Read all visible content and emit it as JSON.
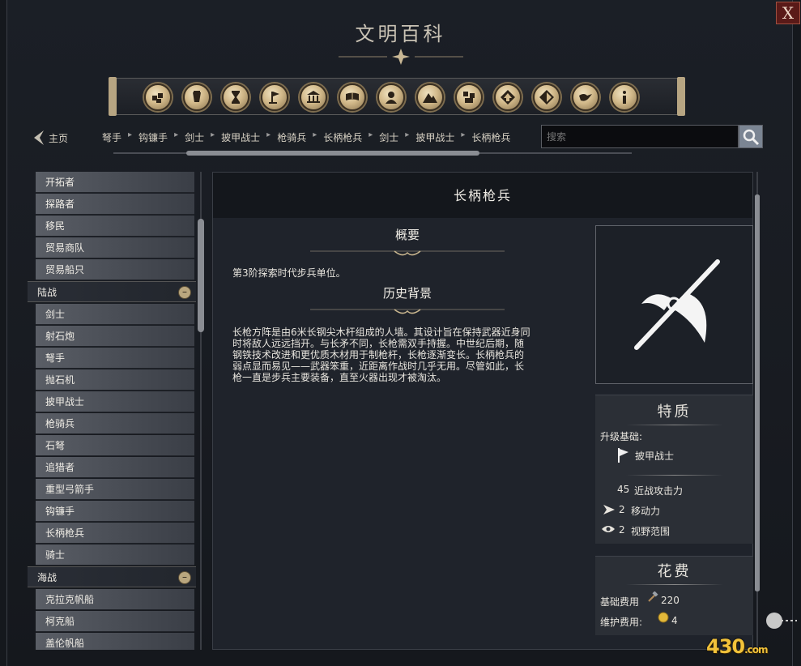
{
  "window": {
    "title": "文明百科",
    "close_label": "X"
  },
  "categories": [
    {
      "name": "units-icon"
    },
    {
      "name": "buildings-icon"
    },
    {
      "name": "wonders-icon"
    },
    {
      "name": "civilizations-icon"
    },
    {
      "name": "government-icon"
    },
    {
      "name": "technology-icon"
    },
    {
      "name": "great-people-icon"
    },
    {
      "name": "terrain-icon"
    },
    {
      "name": "resources-icon"
    },
    {
      "name": "improvements-icon"
    },
    {
      "name": "religion-icon"
    },
    {
      "name": "diplomacy-icon"
    },
    {
      "name": "info-icon"
    }
  ],
  "nav": {
    "home_label": "主页",
    "breadcrumbs": [
      "弩手",
      "钩镰手",
      "剑士",
      "披甲战士",
      "枪骑兵",
      "长柄枪兵",
      "剑士",
      "披甲战士",
      "长柄枪兵"
    ],
    "search_placeholder": "搜索"
  },
  "sidebar": {
    "items_top": [
      "开拓者",
      "探路者",
      "移民",
      "贸易商队",
      "贸易船只"
    ],
    "land_header": "陆战",
    "land_items": [
      "剑士",
      "射石炮",
      "弩手",
      "抛石机",
      "披甲战士",
      "枪骑兵",
      "石弩",
      "追猎者",
      "重型弓箭手",
      "钩镰手",
      "长柄枪兵",
      "骑士"
    ],
    "naval_header": "海战",
    "naval_items": [
      "克拉克帆船",
      "柯克船",
      "盖伦帆船"
    ]
  },
  "article": {
    "title": "长柄枪兵",
    "summary_title": "概要",
    "summary_text": "第3阶探索时代步兵单位。",
    "history_title": "历史背景",
    "history_lines": [
      "长枪方阵是由6米长钢尖木杆组成的人墙。其设计旨在保持武器近身同",
      "时将敌人远远挡开。与长矛不同，长枪需双手持握。中世纪后期，随",
      "钢铁技术改进和更优质木材用于制枪杆，长枪逐渐变长。长柄枪兵的",
      "弱点显而易见——武器笨重，近距离作战时几乎无用。尽管如此，长",
      "枪一直是步兵主要装备，直至火器出现才被淘汰。"
    ]
  },
  "traits": {
    "title": "特质",
    "upgrade_label": "升级基础:",
    "upgrade_unit": "披甲战士",
    "melee": {
      "value": "45",
      "label": "近战攻击力"
    },
    "movement": {
      "value": "2",
      "label": "移动力"
    },
    "sight": {
      "value": "2",
      "label": "视野范围"
    }
  },
  "cost": {
    "title": "花费",
    "base_label": "基础费用",
    "base_value": "220",
    "upkeep_label": "维护费用:",
    "upkeep_value": "4"
  },
  "watermark": {
    "main": "430",
    "suffix": ".com"
  }
}
